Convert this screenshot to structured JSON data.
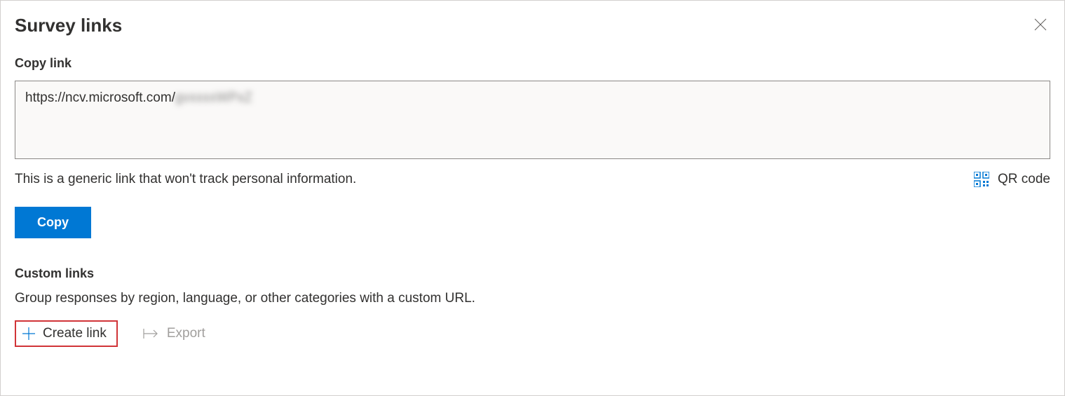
{
  "header": {
    "title": "Survey links"
  },
  "copyLink": {
    "label": "Copy link",
    "urlPrefix": "https://ncv.microsoft.com/",
    "urlSuffix": "gvxxxxWPxZ",
    "info": "This is a generic link that won't track personal information.",
    "qrLabel": "QR code",
    "copyButton": "Copy"
  },
  "customLinks": {
    "label": "Custom links",
    "description": "Group responses by region, language, or other categories with a custom URL.",
    "createLinkLabel": "Create link",
    "exportLabel": "Export"
  }
}
